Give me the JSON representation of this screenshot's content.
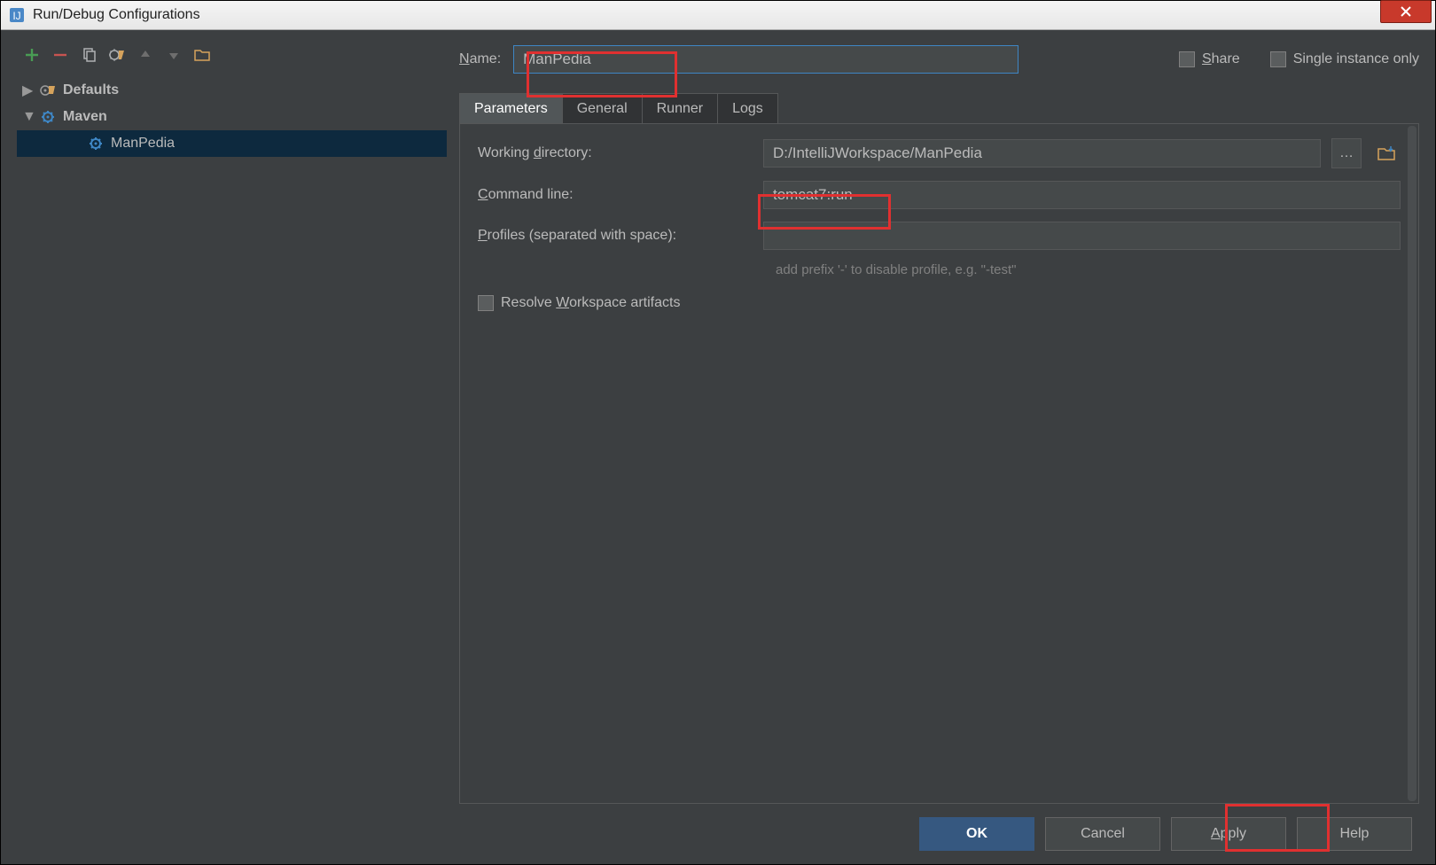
{
  "window": {
    "title": "Run/Debug Configurations"
  },
  "toolbar": {
    "add": "add",
    "remove": "remove",
    "copy": "copy",
    "edit_defaults": "edit defaults",
    "up": "up",
    "down": "down",
    "folder": "folder"
  },
  "tree": {
    "defaults_label": "Defaults",
    "maven_label": "Maven",
    "config_label": "ManPedia"
  },
  "header": {
    "name_label": "Name:",
    "name_value": "ManPedia",
    "share_label": "Share",
    "single_label": "Single instance only"
  },
  "tabs": [
    "Parameters",
    "General",
    "Runner",
    "Logs"
  ],
  "form": {
    "wd_label": "Working directory:",
    "wd_value": "D:/IntelliJWorkspace/ManPedia",
    "cmd_label": "Command line:",
    "cmd_value": "tomcat7:run",
    "profiles_label": "Profiles (separated with space):",
    "profiles_value": "",
    "profiles_hint": "add prefix '-' to disable profile, e.g. \"-test\"",
    "resolve_label": "Resolve Workspace artifacts"
  },
  "buttons": {
    "ok": "OK",
    "cancel": "Cancel",
    "apply": "Apply",
    "help": "Help"
  }
}
